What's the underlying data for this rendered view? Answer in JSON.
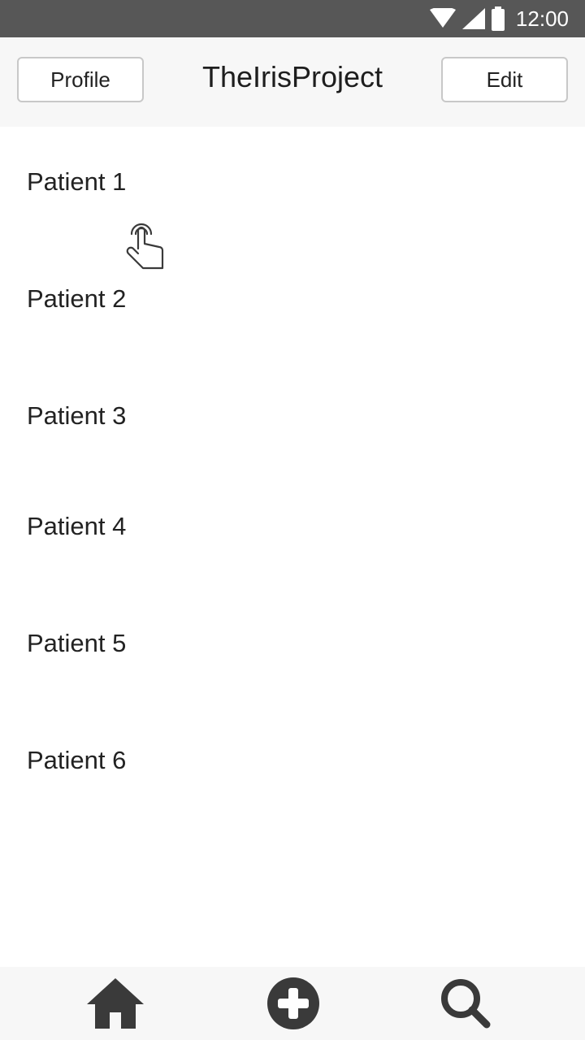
{
  "status_bar": {
    "time": "12:00",
    "icons": [
      "wifi-icon",
      "signal-icon",
      "battery-icon"
    ]
  },
  "header": {
    "title": "TheIrisProject",
    "left_button": "Profile",
    "right_button": "Edit"
  },
  "patients": [
    {
      "label": "Patient 1"
    },
    {
      "label": "Patient 2"
    },
    {
      "label": "Patient 3"
    },
    {
      "label": "Patient 4"
    },
    {
      "label": "Patient 5"
    },
    {
      "label": "Patient 6"
    }
  ],
  "bottom_nav": {
    "items": [
      {
        "icon": "home-icon"
      },
      {
        "icon": "add-circle-icon"
      },
      {
        "icon": "search-icon"
      }
    ]
  },
  "gesture_hint": {
    "icon": "tap-hand-icon"
  },
  "colors": {
    "status_bar_bg": "#575757",
    "header_bg": "#f7f7f7",
    "nav_bg": "#f7f7f7",
    "icon_color": "#3a3a3a",
    "text_color": "#222222"
  }
}
